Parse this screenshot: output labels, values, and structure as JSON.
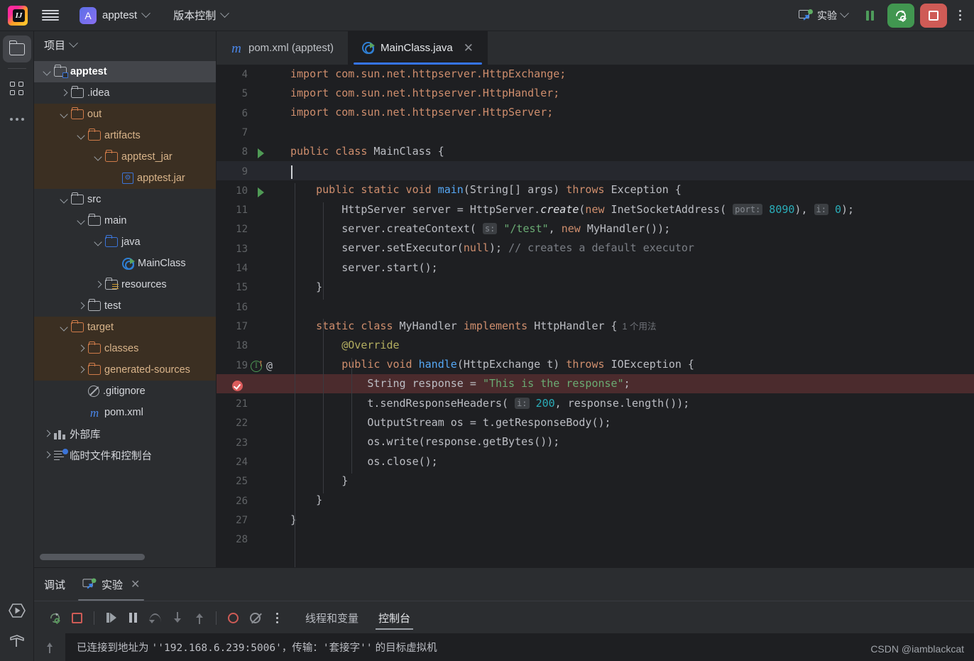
{
  "topbar": {
    "logo_name": "intellij-idea-logo",
    "menu_icon": "hamburger-menu-icon",
    "project_initial": "A",
    "project_name": "apptest",
    "vcs_label": "版本控制",
    "run_config_label": "实验",
    "pause_title": "暂停",
    "debug_title": "调试",
    "stop_title": "停止",
    "more_title": "更多"
  },
  "rail": {
    "items": [
      {
        "name": "project-tool-window",
        "icon": "folder-icon",
        "active": true
      },
      {
        "name": "structure-tool-window",
        "icon": "grid-icon",
        "active": false
      },
      {
        "name": "more-tool-windows",
        "icon": "ellipsis-icon",
        "active": false
      }
    ],
    "bottom_items": [
      {
        "name": "run-tool-window",
        "icon": "run-hexagon-icon"
      },
      {
        "name": "build-tool-window",
        "icon": "hammer-icon"
      }
    ]
  },
  "project": {
    "header": "项目",
    "tree": [
      {
        "label": "apptest",
        "indent": 0,
        "arrow": "down",
        "icon": "folder-module",
        "state": "selected"
      },
      {
        "label": ".idea",
        "indent": 1,
        "arrow": "right",
        "icon": "folder",
        "state": "normal"
      },
      {
        "label": "out",
        "indent": 1,
        "arrow": "down",
        "icon": "folder-orange",
        "state": "excluded"
      },
      {
        "label": "artifacts",
        "indent": 2,
        "arrow": "down",
        "icon": "folder-orange",
        "state": "excluded"
      },
      {
        "label": "apptest_jar",
        "indent": 3,
        "arrow": "down",
        "icon": "folder-orange",
        "state": "excluded"
      },
      {
        "label": "apptest.jar",
        "indent": 4,
        "arrow": "none",
        "icon": "jar",
        "state": "excluded"
      },
      {
        "label": "src",
        "indent": 1,
        "arrow": "down",
        "icon": "folder",
        "state": "normal"
      },
      {
        "label": "main",
        "indent": 2,
        "arrow": "down",
        "icon": "folder",
        "state": "normal"
      },
      {
        "label": "java",
        "indent": 3,
        "arrow": "down",
        "icon": "folder-blue",
        "state": "normal"
      },
      {
        "label": "MainClass",
        "indent": 4,
        "arrow": "none",
        "icon": "class",
        "state": "normal"
      },
      {
        "label": "resources",
        "indent": 3,
        "arrow": "right",
        "icon": "folder-res",
        "state": "normal"
      },
      {
        "label": "test",
        "indent": 2,
        "arrow": "right",
        "icon": "folder",
        "state": "normal"
      },
      {
        "label": "target",
        "indent": 1,
        "arrow": "down",
        "icon": "folder-orange",
        "state": "excluded"
      },
      {
        "label": "classes",
        "indent": 2,
        "arrow": "right",
        "icon": "folder-orange",
        "state": "excluded"
      },
      {
        "label": "generated-sources",
        "indent": 2,
        "arrow": "right",
        "icon": "folder-orange",
        "state": "excluded"
      },
      {
        "label": ".gitignore",
        "indent": 2,
        "arrow": "none",
        "icon": "gitignore",
        "state": "normal"
      },
      {
        "label": "pom.xml",
        "indent": 2,
        "arrow": "none",
        "icon": "maven",
        "state": "normal"
      },
      {
        "label": "外部库",
        "indent": 0,
        "arrow": "right",
        "icon": "library",
        "state": "normal"
      },
      {
        "label": "临时文件和控制台",
        "indent": 0,
        "arrow": "right",
        "icon": "scratch",
        "state": "normal"
      }
    ]
  },
  "editor": {
    "tabs": [
      {
        "label": "pom.xml (apptest)",
        "icon": "maven-icon",
        "active": false,
        "closable": false
      },
      {
        "label": "MainClass.java",
        "icon": "java-class-run-icon",
        "active": true,
        "closable": true,
        "close_glyph": "✕"
      }
    ],
    "first_line_number": 4,
    "lines": [
      {
        "n": 4,
        "tokens": [
          {
            "t": "import com.sun.net.httpserver.HttpExchange;",
            "c": "kw"
          }
        ],
        "indent": 0
      },
      {
        "n": 5,
        "tokens": [
          {
            "t": "import com.sun.net.httpserver.HttpHandler;",
            "c": "kw"
          }
        ],
        "indent": 0
      },
      {
        "n": 6,
        "tokens": [
          {
            "t": "import com.sun.net.httpserver.HttpServer;",
            "c": "kw"
          }
        ],
        "indent": 0
      },
      {
        "n": 7,
        "tokens": [],
        "indent": 0
      },
      {
        "n": 8,
        "gutter": "run-arrow",
        "tokens": [
          {
            "t": "public class ",
            "c": "kw"
          },
          {
            "t": "MainClass {",
            "c": "pln"
          }
        ],
        "indent": 0
      },
      {
        "n": 9,
        "current": true,
        "caret": true,
        "tokens": [],
        "indent": 0
      },
      {
        "n": 10,
        "gutter": "run-arrow",
        "tokens": [
          {
            "t": "    public static void ",
            "c": "kw"
          },
          {
            "t": "main",
            "c": "mth"
          },
          {
            "t": "(String[] args) ",
            "c": "pln"
          },
          {
            "t": "throws ",
            "c": "kw"
          },
          {
            "t": "Exception {",
            "c": "pln"
          }
        ],
        "indent": 1
      },
      {
        "n": 11,
        "tokens": [
          {
            "t": "        HttpServer server = HttpServer.",
            "c": "pln"
          },
          {
            "t": "create",
            "c": "ital"
          },
          {
            "t": "(",
            "c": "pln"
          },
          {
            "t": "new ",
            "c": "kw"
          },
          {
            "t": "InetSocketAddress( ",
            "c": "pln"
          },
          {
            "t": "port:",
            "c": "hint"
          },
          {
            "t": " ",
            "c": "pln"
          },
          {
            "t": "8090",
            "c": "num"
          },
          {
            "t": "), ",
            "c": "pln"
          },
          {
            "t": "i:",
            "c": "hint"
          },
          {
            "t": " ",
            "c": "pln"
          },
          {
            "t": "0",
            "c": "num"
          },
          {
            "t": ");",
            "c": "pln"
          }
        ],
        "indent": 2
      },
      {
        "n": 12,
        "tokens": [
          {
            "t": "        server.createContext( ",
            "c": "pln"
          },
          {
            "t": "s:",
            "c": "hint"
          },
          {
            "t": " ",
            "c": "pln"
          },
          {
            "t": "\"/test\"",
            "c": "str"
          },
          {
            "t": ", ",
            "c": "pln"
          },
          {
            "t": "new ",
            "c": "kw"
          },
          {
            "t": "MyHandler());",
            "c": "pln"
          }
        ],
        "indent": 2
      },
      {
        "n": 13,
        "tokens": [
          {
            "t": "        server.setExecutor(",
            "c": "pln"
          },
          {
            "t": "null",
            "c": "kw"
          },
          {
            "t": "); ",
            "c": "pln"
          },
          {
            "t": "// creates a default executor",
            "c": "cmt"
          }
        ],
        "indent": 2
      },
      {
        "n": 14,
        "tokens": [
          {
            "t": "        server.start();",
            "c": "pln"
          }
        ],
        "indent": 2
      },
      {
        "n": 15,
        "tokens": [
          {
            "t": "    }",
            "c": "pln"
          }
        ],
        "indent": 1
      },
      {
        "n": 16,
        "tokens": [],
        "indent": 0
      },
      {
        "n": 17,
        "tokens": [
          {
            "t": "    static class ",
            "c": "kw"
          },
          {
            "t": "MyHandler ",
            "c": "pln"
          },
          {
            "t": "implements ",
            "c": "kw"
          },
          {
            "t": "HttpHandler {",
            "c": "pln"
          },
          {
            "t": "  1 个用法",
            "c": "usage"
          }
        ],
        "indent": 1
      },
      {
        "n": 18,
        "tokens": [
          {
            "t": "        @Override",
            "c": "ann"
          }
        ],
        "indent": 2
      },
      {
        "n": 19,
        "gutter": "implements",
        "tokens": [
          {
            "t": "        public void ",
            "c": "kw"
          },
          {
            "t": "handle",
            "c": "mth"
          },
          {
            "t": "(HttpExchange t) ",
            "c": "pln"
          },
          {
            "t": "throws ",
            "c": "kw"
          },
          {
            "t": "IOException {",
            "c": "pln"
          }
        ],
        "indent": 2
      },
      {
        "n": 20,
        "gutter": "breakpoint",
        "breakpoint": true,
        "hide_number": true,
        "tokens": [
          {
            "t": "            String response = ",
            "c": "pln"
          },
          {
            "t": "\"This is the response\"",
            "c": "str"
          },
          {
            "t": ";",
            "c": "pln"
          }
        ],
        "indent": 3
      },
      {
        "n": 21,
        "tokens": [
          {
            "t": "            t.sendResponseHeaders( ",
            "c": "pln"
          },
          {
            "t": "i:",
            "c": "hint"
          },
          {
            "t": " ",
            "c": "pln"
          },
          {
            "t": "200",
            "c": "num"
          },
          {
            "t": ", response.length());",
            "c": "pln"
          }
        ],
        "indent": 3
      },
      {
        "n": 22,
        "tokens": [
          {
            "t": "            OutputStream os = t.getResponseBody();",
            "c": "pln"
          }
        ],
        "indent": 3
      },
      {
        "n": 23,
        "tokens": [
          {
            "t": "            os.write(response.getBytes());",
            "c": "pln"
          }
        ],
        "indent": 3
      },
      {
        "n": 24,
        "tokens": [
          {
            "t": "            os.close();",
            "c": "pln"
          }
        ],
        "indent": 3
      },
      {
        "n": 25,
        "tokens": [
          {
            "t": "        }",
            "c": "pln"
          }
        ],
        "indent": 2
      },
      {
        "n": 26,
        "tokens": [
          {
            "t": "    }",
            "c": "pln"
          }
        ],
        "indent": 1
      },
      {
        "n": 27,
        "tokens": [
          {
            "t": "}",
            "c": "pln"
          }
        ],
        "indent": 0
      },
      {
        "n": 28,
        "tokens": [],
        "indent": 0
      }
    ]
  },
  "debug": {
    "panel_title": "调试",
    "session_tab": "实验",
    "session_close_glyph": "✕",
    "toolbar": [
      {
        "name": "rerun-debug-button",
        "icon": "restart-debug-icon"
      },
      {
        "name": "stop-button",
        "icon": "stop-icon"
      },
      {
        "name": "resume-program-button",
        "icon": "resume-icon"
      },
      {
        "name": "pause-program-button",
        "icon": "pause-icon"
      },
      {
        "name": "step-over-button",
        "icon": "step-over-icon"
      },
      {
        "name": "step-into-button",
        "icon": "step-into-icon"
      },
      {
        "name": "step-out-button",
        "icon": "step-out-icon"
      },
      {
        "name": "view-breakpoints-button",
        "icon": "breakpoints-icon"
      },
      {
        "name": "mute-breakpoints-button",
        "icon": "mute-breakpoints-icon"
      },
      {
        "name": "debug-more-button",
        "icon": "vertical-dots-icon"
      }
    ],
    "view_tabs": [
      {
        "label": "线程和变量",
        "active": false
      },
      {
        "label": "控制台",
        "active": true
      }
    ],
    "console_message_prefix": "已连接到地址为 ",
    "console_address": "''192.168.6.239:5006'",
    "console_message_mid": "，传输：",
    "console_transport": "'套接字''",
    "console_message_suffix": " 的目标虚拟机"
  },
  "watermark": "CSDN @iamblackcat",
  "colors": {
    "accent_blue": "#3574f0",
    "run_green": "#419650",
    "stop_red": "#cf5b56",
    "excluded_bg": "#3b2f22",
    "breakpoint_red": "#db5c5c",
    "editor_bg": "#1e1f22",
    "panel_bg": "#2b2d30"
  }
}
